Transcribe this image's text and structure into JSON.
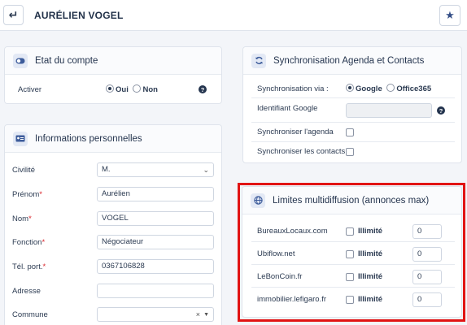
{
  "header": {
    "back_icon": "return-arrow-icon",
    "title": "AURÉLIEN VOGEL",
    "favorite_icon": "star-icon"
  },
  "etat_compte": {
    "title": "Etat du compte",
    "icon": "toggle-icon",
    "activer_label": "Activer",
    "options": [
      "Oui",
      "Non"
    ],
    "selected": "Oui",
    "help": "?"
  },
  "infos": {
    "title": "Informations personnelles",
    "icon": "id-card-icon",
    "civilite_label": "Civilité",
    "civilite_value": "M.",
    "prenom_label": "Prénom",
    "prenom_value": "Aurélien",
    "nom_label": "Nom",
    "nom_value": "VOGEL",
    "fonction_label": "Fonction",
    "fonction_value": "Négociateur",
    "tel_label": "Tél. port.",
    "tel_value": "0367106828",
    "adresse_label": "Adresse",
    "adresse_value": "",
    "commune_label": "Commune",
    "commune_value": "",
    "required_mark": "*",
    "clear_mark": "×"
  },
  "sync": {
    "title": "Synchronisation Agenda et Contacts",
    "icon": "sync-icon",
    "via_label": "Synchronisation via :",
    "via_options": [
      "Google",
      "Office365"
    ],
    "via_selected": "Google",
    "google_id_label": "Identifiant Google",
    "google_id_value": "",
    "agenda_label": "Synchroniser l'agenda",
    "contacts_label": "Synchroniser les contacts",
    "help": "?"
  },
  "multidiff": {
    "title": "Limites multidiffusion (annonces max)",
    "icon": "globe-icon",
    "unlimited_label": "Illimité",
    "rows": [
      {
        "name": "BureauxLocaux.com",
        "value": "0"
      },
      {
        "name": "Ubiflow.net",
        "value": "0"
      },
      {
        "name": "LeBonCoin.fr",
        "value": "0"
      },
      {
        "name": "immobilier.lefigaro.fr",
        "value": "0"
      }
    ]
  },
  "colors": {
    "accent": "#344e86",
    "highlight": "#e11414",
    "required": "#d9262c"
  }
}
